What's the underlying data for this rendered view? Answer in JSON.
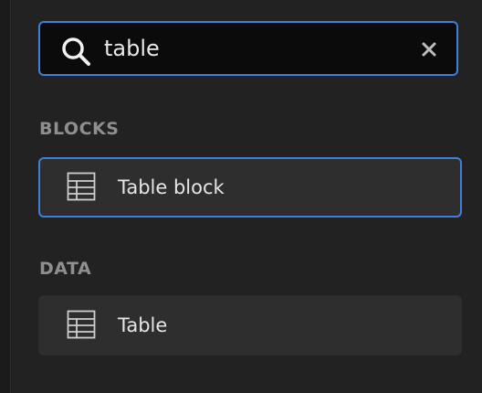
{
  "search": {
    "value": "table",
    "icon": "search-icon",
    "clear_icon": "close-icon"
  },
  "sections": [
    {
      "heading": "BLOCKS",
      "items": [
        {
          "label": "Table block",
          "icon": "table-icon",
          "selected": true
        }
      ]
    },
    {
      "heading": "DATA",
      "items": [
        {
          "label": "Table",
          "icon": "table-icon",
          "selected": false
        }
      ]
    }
  ],
  "colors": {
    "accent": "#3f7fd9",
    "background": "#222222",
    "item_background": "#2e2e2e"
  }
}
